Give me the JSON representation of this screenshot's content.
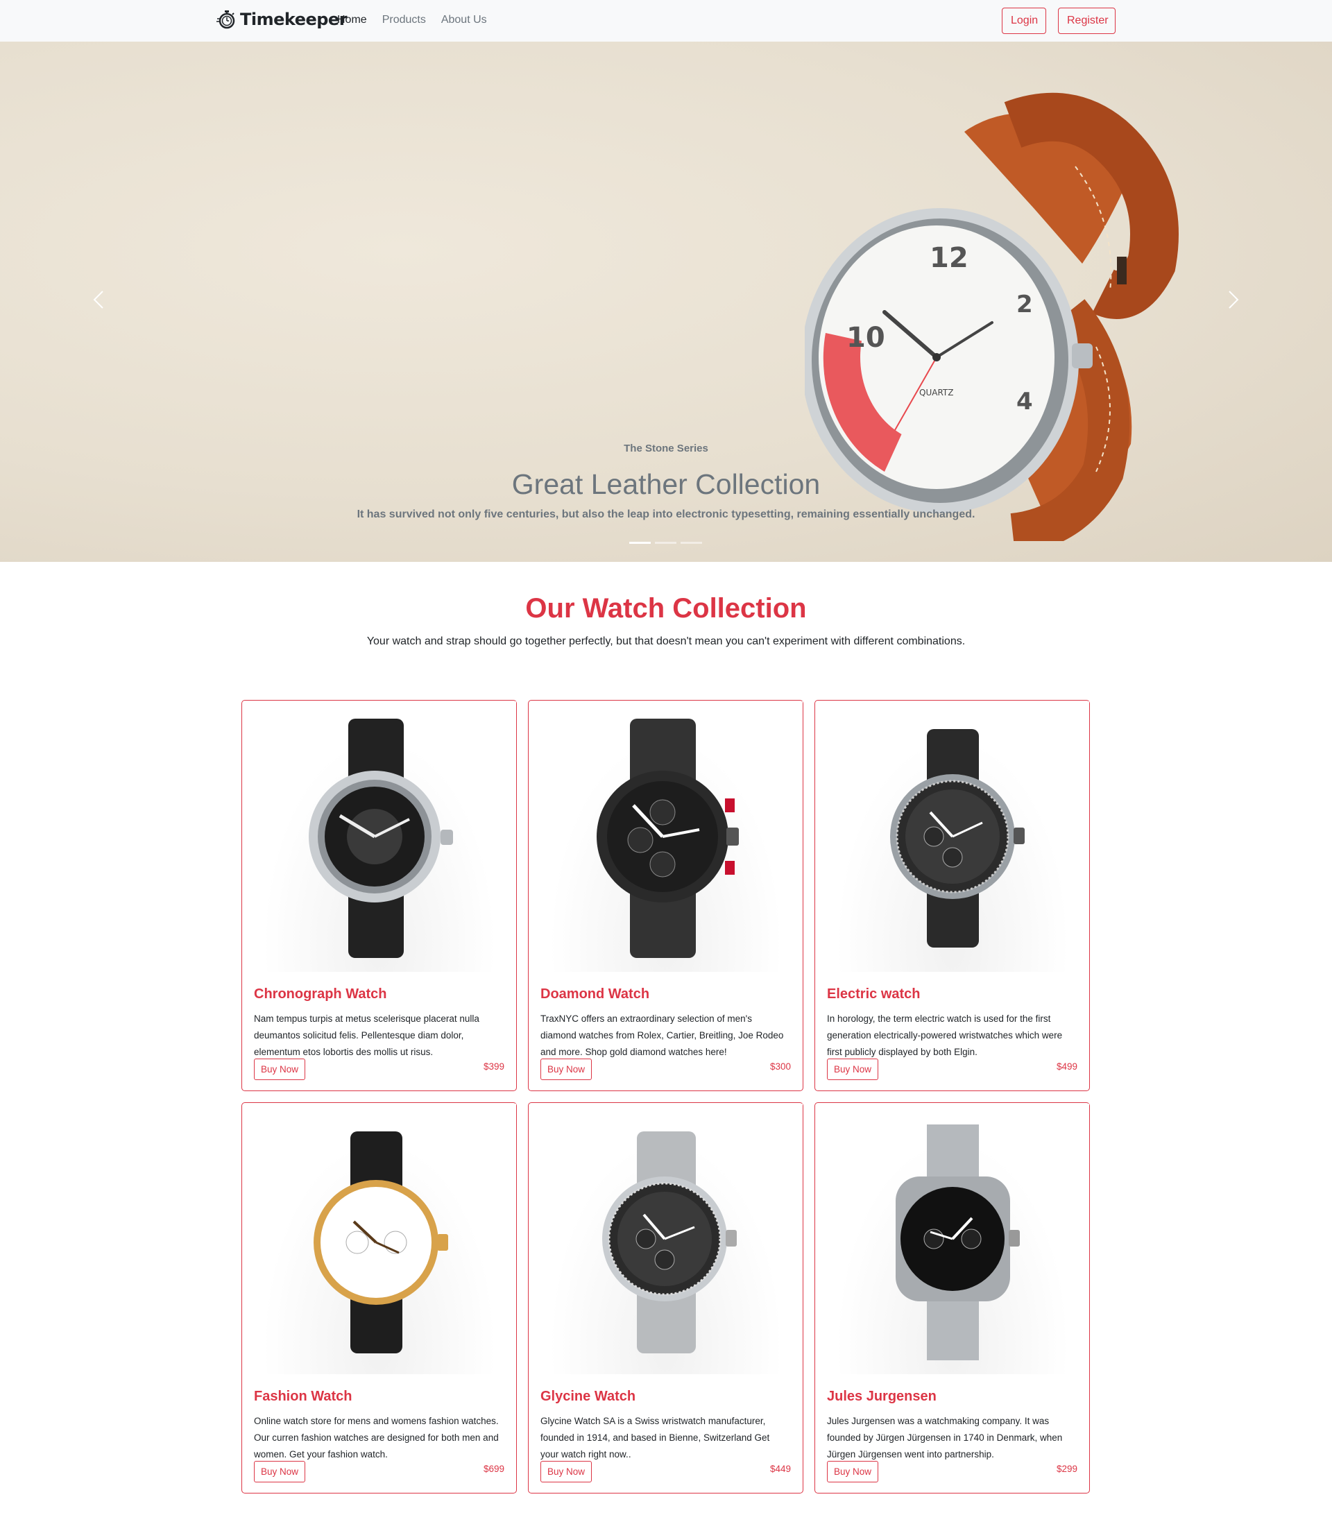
{
  "navbar": {
    "brand": "Timekeeper",
    "links": [
      {
        "label": "Home",
        "active": true
      },
      {
        "label": "Products",
        "active": false
      },
      {
        "label": "About Us",
        "active": false
      }
    ],
    "login": "Login",
    "register": "Register"
  },
  "hero": {
    "kicker": "The Stone Series",
    "title": "Great Leather Collection",
    "text": "It has survived not only five centuries, but also the leap into electronic typesetting, remaining essentially unchanged.",
    "slide_count": 3,
    "active_slide": 1
  },
  "collection": {
    "title": "Our Watch Collection",
    "subtitle": "Your watch and strap should go together perfectly, but that doesn't mean you can't experiment with different combinations."
  },
  "products": [
    {
      "title": "Chronograph Watch",
      "text": "Nam tempus turpis at metus scelerisque placerat nulla deumantos solicitud felis. Pellentesque diam dolor, elementum etos lobortis des mollis ut risus.",
      "price": "$399",
      "button": "Buy Now"
    },
    {
      "title": "Doamond Watch",
      "text": "TraxNYC offers an extraordinary selection of men's diamond watches from Rolex, Cartier, Breitling, Joe Rodeo and more. Shop gold diamond watches here!",
      "price": "$300",
      "button": "Buy Now"
    },
    {
      "title": "Electric watch",
      "text": "In horology, the term electric watch is used for the first generation electrically-powered wristwatches which were first publicly displayed by both Elgin.",
      "price": "$499",
      "button": "Buy Now"
    },
    {
      "title": "Fashion Watch",
      "text": "Online watch store for mens and womens fashion watches. Our curren fashion watches are designed for both men and women. Get your fashion watch.",
      "price": "$699",
      "button": "Buy Now"
    },
    {
      "title": "Glycine Watch",
      "text": "Glycine Watch SA is a Swiss wristwatch manufacturer, founded in 1914, and based in Bienne, Switzerland Get your watch right now..",
      "price": "$449",
      "button": "Buy Now"
    },
    {
      "title": "Jules Jurgensen",
      "text": "Jules Jurgensen was a watchmaking company. It was founded by Jürgen Jürgensen in 1740 in Denmark, when Jürgen Jürgensen went into partnership.",
      "price": "$299",
      "button": "Buy Now"
    }
  ],
  "colors": {
    "accent": "#dc3545",
    "muted": "#6c757d",
    "navbar_bg": "#f8f9fa"
  },
  "icons": {
    "brand": "stopwatch-icon",
    "prev": "chevron-left-icon",
    "next": "chevron-right-icon",
    "product": "wristwatch-icon"
  }
}
